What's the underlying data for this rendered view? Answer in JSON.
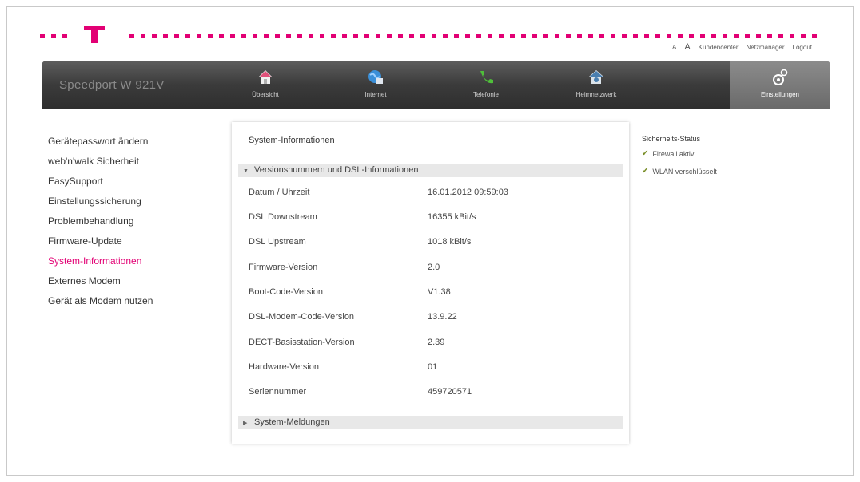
{
  "header": {
    "links": {
      "font_small": "A",
      "font_large": "A",
      "customer_center": "Kundencenter",
      "network_manager": "Netzmanager",
      "logout": "Logout"
    }
  },
  "navbar": {
    "brand": "Speedport W 921V",
    "items": [
      {
        "label": "Übersicht",
        "icon": "house-icon"
      },
      {
        "label": "Internet",
        "icon": "globe-icon"
      },
      {
        "label": "Telefonie",
        "icon": "phone-icon"
      },
      {
        "label": "Heimnetzwerk",
        "icon": "home-network-icon"
      },
      {
        "label": "Einstellungen",
        "icon": "gears-icon",
        "active": true
      }
    ]
  },
  "sidebar": {
    "items": [
      {
        "label": "Gerätepasswort ändern"
      },
      {
        "label": "web'n'walk Sicherheit"
      },
      {
        "label": "EasySupport"
      },
      {
        "label": "Einstellungssicherung"
      },
      {
        "label": "Problembehandlung"
      },
      {
        "label": "Firmware-Update"
      },
      {
        "label": "System-Informationen",
        "active": true
      },
      {
        "label": "Externes Modem"
      },
      {
        "label": "Gerät als Modem nutzen"
      }
    ]
  },
  "main": {
    "title": "System-Informationen",
    "section_versions": "Versionsnummern und DSL-Informationen",
    "rows": [
      {
        "key": "Datum / Uhrzeit",
        "value": "16.01.2012 09:59:03"
      },
      {
        "key": "DSL Downstream",
        "value": "16355 kBit/s"
      },
      {
        "key": "DSL Upstream",
        "value": "1018 kBit/s"
      },
      {
        "key": "Firmware-Version",
        "value": "2.0"
      },
      {
        "key": "Boot-Code-Version",
        "value": "V1.38"
      },
      {
        "key": "DSL-Modem-Code-Version",
        "value": "13.9.22"
      },
      {
        "key": "DECT-Basisstation-Version",
        "value": "2.39"
      },
      {
        "key": "Hardware-Version",
        "value": "01"
      },
      {
        "key": "Seriennummer",
        "value": "459720571"
      }
    ],
    "section_messages": "System-Meldungen"
  },
  "security": {
    "title": "Sicherheits-Status",
    "items": [
      {
        "label": "Firewall aktiv"
      },
      {
        "label": "WLAN verschlüsselt"
      }
    ]
  },
  "colors": {
    "brand": "#e20074",
    "nav_dark": "#2e2e2e",
    "check": "#7a8f2a"
  }
}
